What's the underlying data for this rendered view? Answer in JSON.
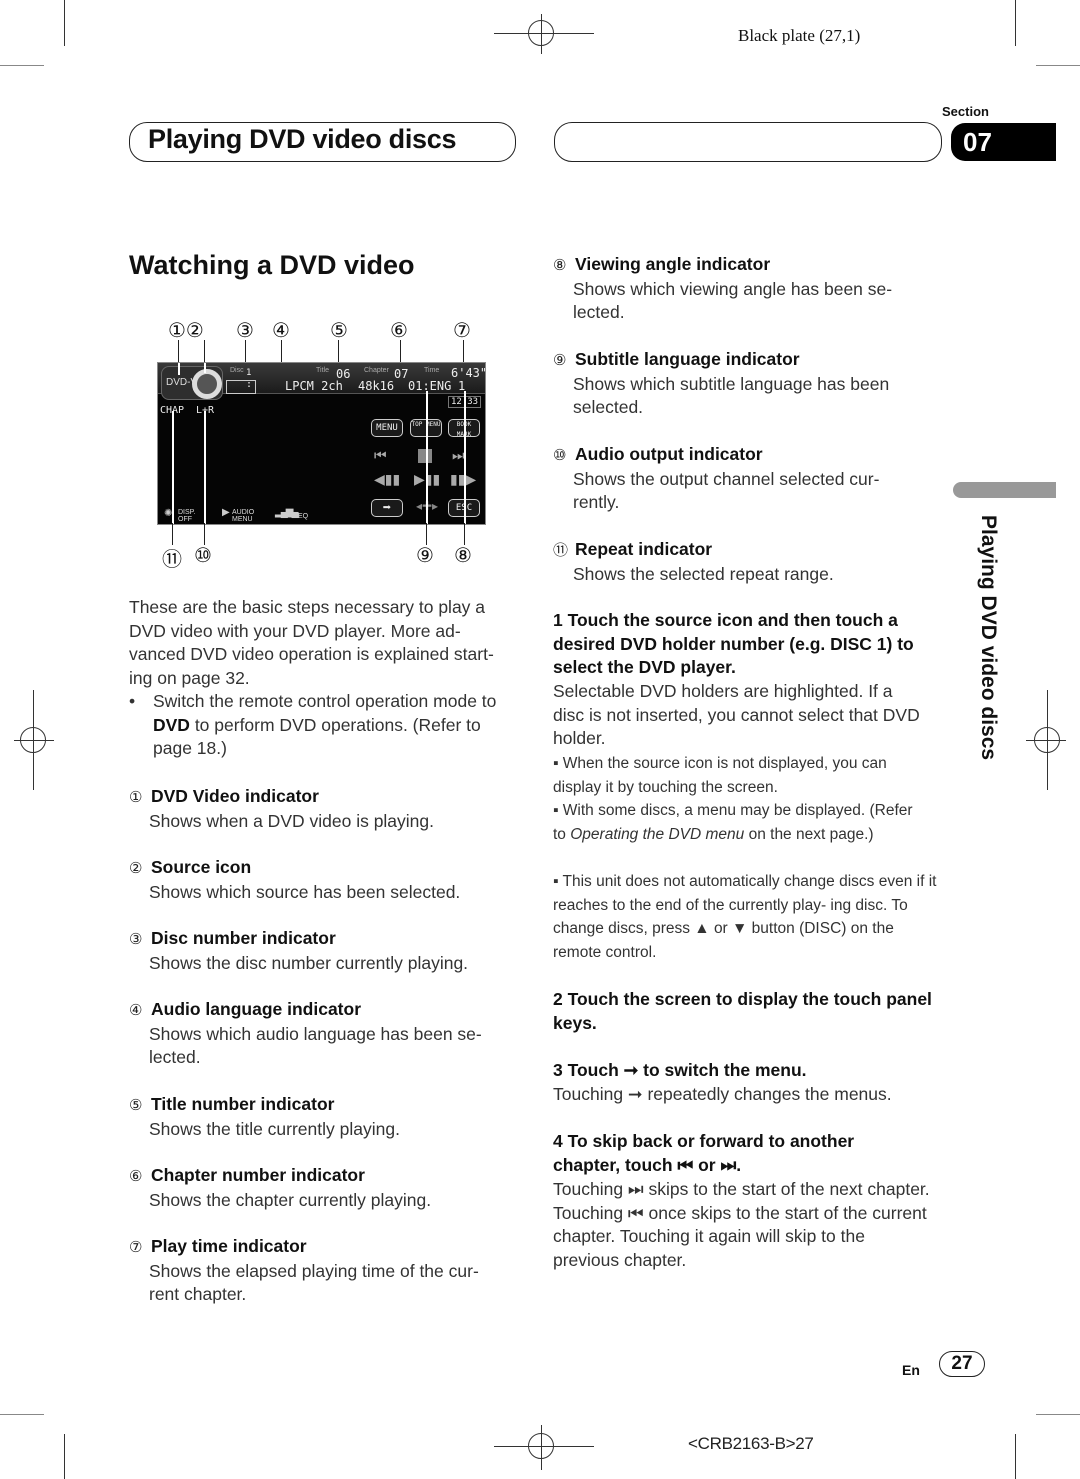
{
  "print_marks": {
    "plate_label": "Black plate (27,1)",
    "job_code": "<CRB2163-B>27"
  },
  "header": {
    "chapter_title": "Playing DVD video discs",
    "section_label": "Section",
    "section_number": "07"
  },
  "side_tab": {
    "label": "Playing DVD video discs"
  },
  "main": {
    "heading": "Watching a DVD video",
    "figure": {
      "top_callouts": [
        "①②",
        "③",
        "④",
        "⑤",
        "⑥",
        "⑦"
      ],
      "bottom_callouts_left": [
        "⑪",
        "⑩"
      ],
      "bottom_callouts_right": [
        "⑨",
        "⑧"
      ],
      "screen": {
        "source_label": "DVD-V",
        "disc_label": "Disc",
        "disc_value": "1",
        "audio_lang_value": ":",
        "audio_format": "LPCM 2ch",
        "title_label": "Title",
        "title_value": "06",
        "chapter_label": "Chapter",
        "chapter_value": "07",
        "time_label": "Time",
        "time_value": "6'43\"",
        "sample_rate": "48k16",
        "subtitle_value": "01:ENG",
        "angle_value": "1",
        "clock": "12:33",
        "repeat_value": "CHAP",
        "audio_output": "L+R",
        "buttons": {
          "menu": "MENU",
          "top_menu": "TOP MENU",
          "bookmark": "BOOK MARK",
          "esc": "ESC",
          "disp_off": "DISP. OFF",
          "audio_menu": "AUDIO MENU",
          "eq": "EQ"
        }
      }
    },
    "intro": "These are the basic steps necessary to play a DVD video with your DVD player. More ad- vanced DVD video operation is explained start- ing on page 32.",
    "bullet": {
      "pre": "Switch the remote control operation mode to ",
      "bold": "DVD",
      "post": " to perform DVD operations. (Refer to page 18.)"
    },
    "indicators": [
      {
        "num": "①",
        "title": "DVD Video indicator",
        "desc": "Shows when a DVD video is playing."
      },
      {
        "num": "②",
        "title": "Source icon",
        "desc": "Shows which source has been selected."
      },
      {
        "num": "③",
        "title": "Disc number indicator",
        "desc": "Shows the disc number currently playing."
      },
      {
        "num": "④",
        "title": "Audio language indicator",
        "desc": "Shows which audio language has been se- lected."
      },
      {
        "num": "⑤",
        "title": "Title number indicator",
        "desc": "Shows the title currently playing."
      },
      {
        "num": "⑥",
        "title": "Chapter number indicator",
        "desc": "Shows the chapter currently playing."
      },
      {
        "num": "⑦",
        "title": "Play time indicator",
        "desc": "Shows the elapsed playing time of the cur- rent chapter."
      },
      {
        "num": "⑧",
        "title": "Viewing angle indicator",
        "desc": "Shows which viewing angle has been se- lected."
      },
      {
        "num": "⑨",
        "title": "Subtitle language indicator",
        "desc": "Shows which subtitle language has been selected."
      },
      {
        "num": "⑩",
        "title": "Audio output indicator",
        "desc": "Shows the output channel selected cur- rently."
      },
      {
        "num": "⑪",
        "title": "Repeat indicator",
        "desc": "Shows the selected repeat range."
      }
    ],
    "steps": [
      {
        "heading": "1    Touch the source icon and then touch a desired DVD holder number (e.g. DISC 1) to select the DVD player.",
        "body": "Selectable DVD holders are highlighted. If a disc is not inserted, you cannot select that DVD holder.",
        "notes": [
          "▪   When the source icon is not displayed, you can display it by touching the screen.",
          {
            "pre": "▪   With some discs, a menu may be displayed. (Refer to ",
            "italic": "Operating the DVD menu",
            "post": " on the next page.)"
          },
          "▪   This unit does not automatically change discs even if it reaches to the end of the currently play- ing disc. To change discs, press ▲ or ▼ button (DISC) on the remote control."
        ]
      },
      {
        "heading": "2    Touch the screen to display the touch panel keys."
      },
      {
        "heading": "3    Touch ➞ to switch the menu.",
        "body": "Touching ➞ repeatedly changes the menus."
      },
      {
        "heading": "4    To skip back or forward to another chapter, touch ⏮ or ⏭.",
        "body": "Touching ⏭ skips to the start of the next chapter. Touching ⏮ once skips to the start of the current chapter. Touching it again will skip to the previous chapter."
      }
    ]
  },
  "footer": {
    "lang": "En",
    "page_number": "27"
  }
}
